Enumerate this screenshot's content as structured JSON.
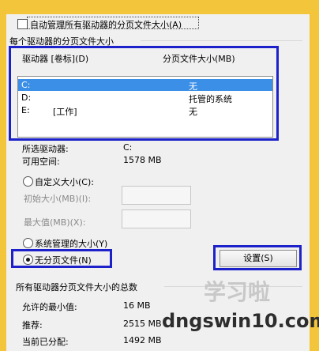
{
  "auto_manage_label": "自动管理所有驱动器的分页文件大小(A)",
  "per_drive_section": "每个驱动器的分页文件大小",
  "drive_header": "驱动器 [卷标](D)",
  "size_header": "分页文件大小(MB)",
  "drives": [
    {
      "drive": "C:",
      "label": "",
      "size": "无"
    },
    {
      "drive": "D:",
      "label": "",
      "size": "托管的系统"
    },
    {
      "drive": "E:",
      "label": "[工作]",
      "size": "无"
    }
  ],
  "selected_drive_label": "所选驱动器:",
  "selected_drive_value": "C:",
  "free_space_label": "可用空间:",
  "free_space_value": "1578 MB",
  "custom_size_label": "自定义大小(C):",
  "initial_size_label": "初始大小(MB)(I):",
  "max_size_label": "最大值(MB)(X):",
  "system_managed_label": "系统管理的大小(Y)",
  "no_paging_label": "无分页文件(N)",
  "set_button": "设置(S)",
  "totals_section": "所有驱动器分页文件大小的总数",
  "min_allowed_label": "允许的最小值:",
  "min_allowed_value": "16 MB",
  "recommended_label": "推荐:",
  "recommended_value": "2515 MB",
  "current_label": "当前已分配:",
  "current_value": "1492 MB",
  "watermark_text": "dngswin10.com",
  "watermark_cn": "学习啦",
  "colors": {
    "frame": "#f3c53a",
    "highlight": "#1c21c9",
    "selection": "#3c8fe6"
  }
}
